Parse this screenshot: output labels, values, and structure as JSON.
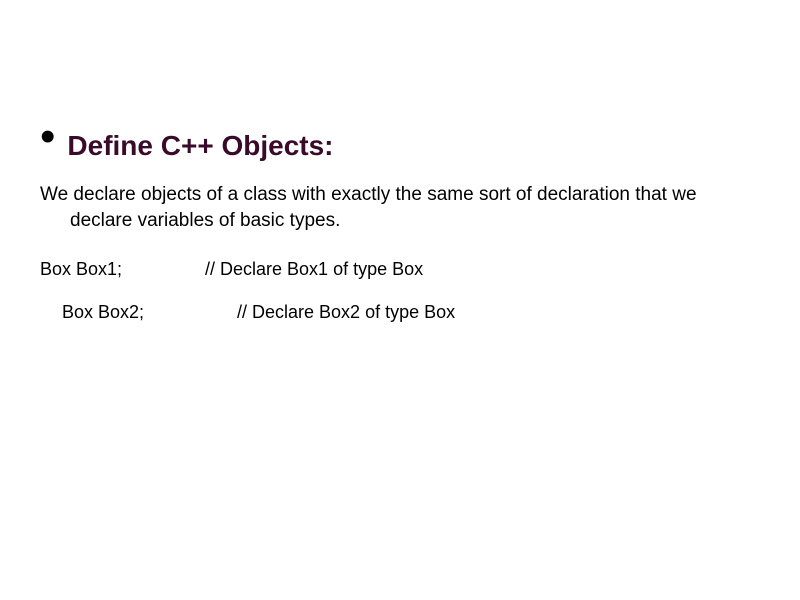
{
  "heading": "Define C++ Objects:",
  "body": "We declare objects of a class with exactly the same sort of declaration that we declare variables of basic types.",
  "lines": [
    {
      "decl": "Box Box1;",
      "comment": "// Declare Box1 of type Box"
    },
    {
      "decl": "Box Box2;",
      "comment": "// Declare Box2 of type Box"
    }
  ]
}
